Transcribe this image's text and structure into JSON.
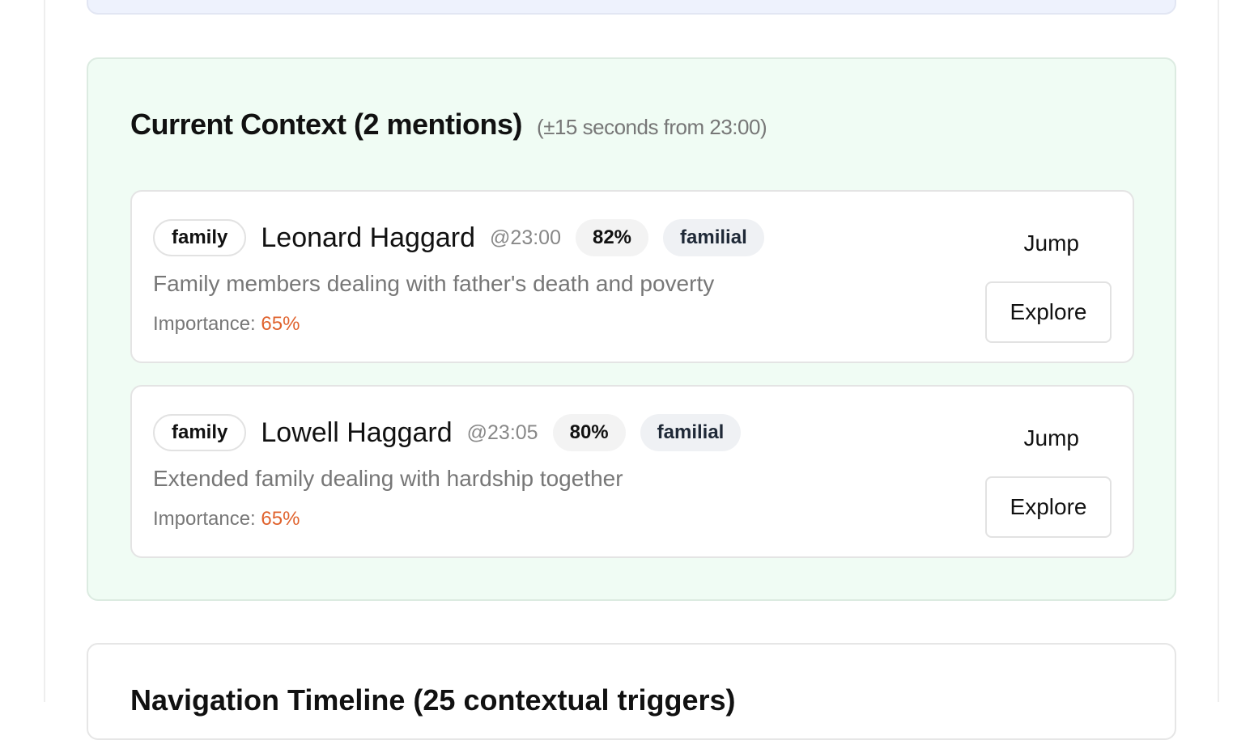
{
  "context": {
    "title": "Current Context (2 mentions)",
    "subtitle": "(±15 seconds from 23:00)",
    "items": [
      {
        "category": "family",
        "name": "Leonard Haggard",
        "time": "@23:00",
        "score": "82%",
        "relation": "familial",
        "description": "Family members dealing with father's death and poverty",
        "importance_label": "Importance:",
        "importance": "65%",
        "jump": "Jump",
        "explore": "Explore"
      },
      {
        "category": "family",
        "name": "Lowell Haggard",
        "time": "@23:05",
        "score": "80%",
        "relation": "familial",
        "description": "Extended family dealing with hardship together",
        "importance_label": "Importance:",
        "importance": "65%",
        "jump": "Jump",
        "explore": "Explore"
      }
    ]
  },
  "timeline": {
    "title": "Navigation Timeline (25 contextual triggers)"
  },
  "colors": {
    "accent": "#e0632e",
    "context_bg": "#f0fcf4"
  }
}
